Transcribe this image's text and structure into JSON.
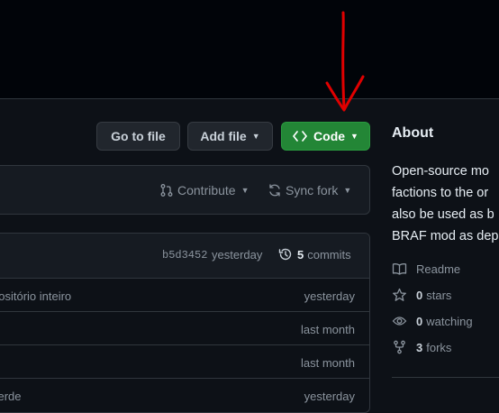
{
  "toolbar": {
    "go_to_file": "Go to file",
    "add_file": "Add file",
    "code": "Code"
  },
  "fork_bar": {
    "contribute": "Contribute",
    "sync_fork": "Sync fork"
  },
  "commit_bar": {
    "hash": "b5d3452",
    "time": "yesterday",
    "commits_count": "5",
    "commits_label": "commits"
  },
  "files": [
    {
      "message": "positório inteiro",
      "time": "yesterday"
    },
    {
      "message": "",
      "time": "last month"
    },
    {
      "message": "",
      "time": "last month"
    },
    {
      "message": "verde",
      "time": "yesterday"
    }
  ],
  "about": {
    "heading": "About",
    "description_lines": [
      "Open-source mo",
      "factions to the or",
      "also be used as b",
      "BRAF mod as dep"
    ],
    "readme": "Readme",
    "stars_count": "0",
    "stars_label": "stars",
    "watching_count": "0",
    "watching_label": "watching",
    "forks_count": "3",
    "forks_label": "forks"
  },
  "colors": {
    "accent_green": "#238636",
    "annotation_red": "#e00000"
  },
  "icons": [
    "code-icon",
    "caret-down-icon",
    "git-pull-request-icon",
    "sync-icon",
    "history-icon",
    "book-icon",
    "star-icon",
    "eye-icon",
    "repo-forked-icon"
  ]
}
